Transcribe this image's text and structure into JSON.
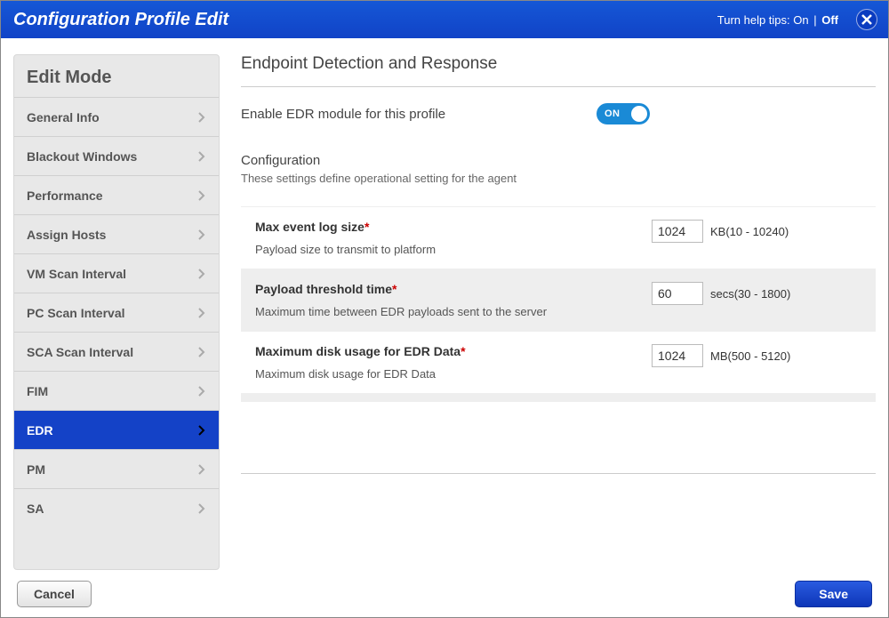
{
  "dialog": {
    "title": "Configuration Profile Edit",
    "help_prefix": "Turn help tips: ",
    "help_on": "On",
    "help_sep": " | ",
    "help_off": "Off"
  },
  "sidebar": {
    "title": "Edit Mode",
    "items": [
      {
        "label": "General Info",
        "active": false
      },
      {
        "label": "Blackout Windows",
        "active": false
      },
      {
        "label": "Performance",
        "active": false
      },
      {
        "label": "Assign Hosts",
        "active": false
      },
      {
        "label": "VM Scan Interval",
        "active": false
      },
      {
        "label": "PC Scan Interval",
        "active": false
      },
      {
        "label": "SCA Scan Interval",
        "active": false
      },
      {
        "label": "FIM",
        "active": false
      },
      {
        "label": "EDR",
        "active": true
      },
      {
        "label": "PM",
        "active": false
      },
      {
        "label": "SA",
        "active": false
      }
    ]
  },
  "panel": {
    "heading": "Endpoint Detection and Response",
    "enable_label": "Enable EDR module for this profile",
    "toggle_text": "ON",
    "config_head": "Configuration",
    "config_sub": "These settings define operational setting for the agent",
    "fields": [
      {
        "label": "Max event log size",
        "desc": "Payload size to transmit to platform",
        "value": "1024",
        "unit": "KB(10 - 10240)"
      },
      {
        "label": "Payload threshold time",
        "desc": "Maximum time between EDR payloads sent to the server",
        "value": "60",
        "unit": "secs(30 - 1800)"
      },
      {
        "label": "Maximum disk usage for EDR Data",
        "desc": "Maximum disk usage for EDR Data",
        "value": "1024",
        "unit": "MB(500 - 5120)"
      }
    ]
  },
  "footer": {
    "cancel": "Cancel",
    "save": "Save"
  }
}
